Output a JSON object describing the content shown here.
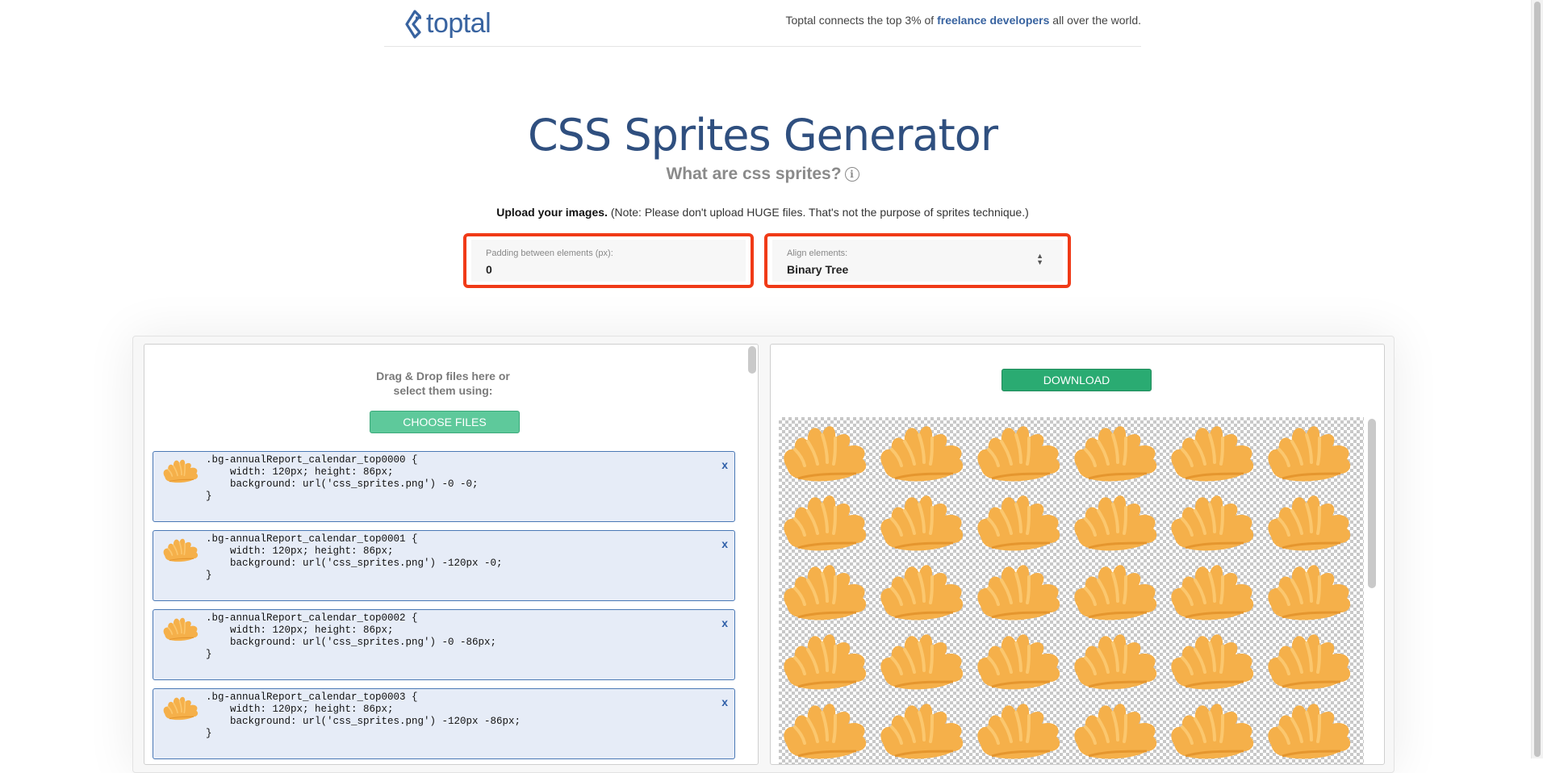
{
  "header": {
    "logo_text": "toptal",
    "tagline_before": "Toptal connects the top 3% of ",
    "tagline_link": "freelance developers",
    "tagline_after": " all over the world."
  },
  "page": {
    "title": "CSS Sprites Generator",
    "subtitle": "What are css sprites?",
    "info_icon": "i",
    "upload_bold": "Upload your images.",
    "upload_note": " (Note: Please don't upload HUGE files. That's not the purpose of sprites technique.)"
  },
  "padding_field": {
    "label": "Padding between elements (px):",
    "value": "0"
  },
  "align_field": {
    "label": "Align elements:",
    "value": "Binary Tree",
    "arrows_icon": "updown-arrows-icon"
  },
  "left_panel": {
    "drop_line1": "Drag & Drop files here or",
    "drop_line2": "select them using:",
    "choose_files_label": "CHOOSE FILES",
    "items": [
      {
        "line1": ".bg-annualReport_calendar_top0000 {",
        "line2": "    width: 120px; height: 86px;",
        "line3": "    background: url('css_sprites.png') -0 -0;",
        "line4": "}",
        "remove": "x"
      },
      {
        "line1": ".bg-annualReport_calendar_top0001 {",
        "line2": "    width: 120px; height: 86px;",
        "line3": "    background: url('css_sprites.png') -120px -0;",
        "line4": "}",
        "remove": "x"
      },
      {
        "line1": ".bg-annualReport_calendar_top0002 {",
        "line2": "    width: 120px; height: 86px;",
        "line3": "    background: url('css_sprites.png') -0 -86px;",
        "line4": "}",
        "remove": "x"
      },
      {
        "line1": ".bg-annualReport_calendar_top0003 {",
        "line2": "    width: 120px; height: 86px;",
        "line3": "    background: url('css_sprites.png') -120px -86px;",
        "line4": "}",
        "remove": "x"
      }
    ]
  },
  "right_panel": {
    "download_label": "DOWNLOAD"
  },
  "colors": {
    "accent_blue": "#3863a0",
    "title_blue": "#2f4f7f",
    "highlight_red": "#f03a17",
    "choose_green": "#5ec99b",
    "download_green": "#2aab72",
    "sprite_orange": "#f5b04a"
  }
}
